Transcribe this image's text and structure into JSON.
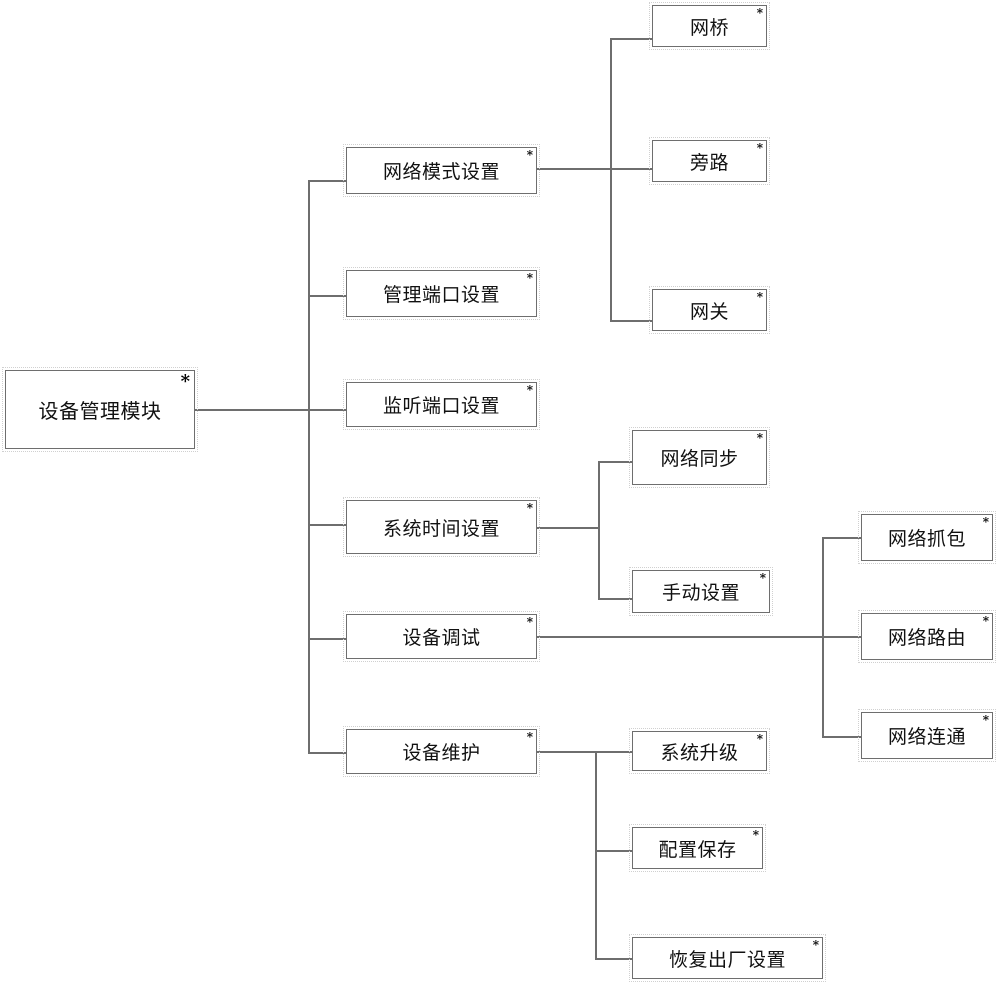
{
  "diagram": {
    "root": {
      "label": "设备管理模块",
      "marker": "*"
    },
    "children": [
      {
        "label": "网络模式设置",
        "marker": "*",
        "children": [
          {
            "label": "网桥",
            "marker": "*"
          },
          {
            "label": "旁路",
            "marker": "*"
          },
          {
            "label": "网关",
            "marker": "*"
          }
        ]
      },
      {
        "label": "管理端口设置",
        "marker": "*",
        "children": []
      },
      {
        "label": "监听端口设置",
        "marker": "*",
        "children": []
      },
      {
        "label": "系统时间设置",
        "marker": "*",
        "children": [
          {
            "label": "网络同步",
            "marker": "*"
          },
          {
            "label": "手动设置",
            "marker": "*"
          }
        ]
      },
      {
        "label": "设备调试",
        "marker": "*",
        "children": [
          {
            "label": "网络抓包",
            "marker": "*"
          },
          {
            "label": "网络路由",
            "marker": "*"
          },
          {
            "label": "网络连通",
            "marker": "*"
          }
        ]
      },
      {
        "label": "设备维护",
        "marker": "*",
        "children": [
          {
            "label": "系统升级",
            "marker": "*"
          },
          {
            "label": "配置保存",
            "marker": "*"
          },
          {
            "label": "恢复出厂设置",
            "marker": "*"
          }
        ]
      }
    ]
  }
}
